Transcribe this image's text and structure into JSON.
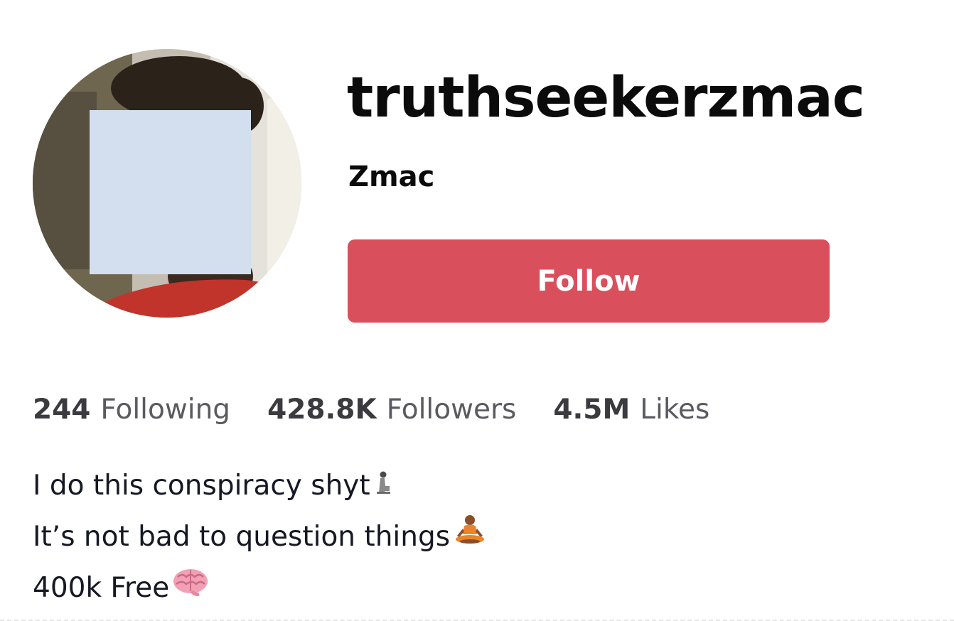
{
  "profile": {
    "username": "truthseekerzmac",
    "display_name": "Zmac",
    "follow_label": "Follow"
  },
  "stats": {
    "following": {
      "value": "244",
      "label": "Following"
    },
    "followers": {
      "value": "428.8K",
      "label": "Followers"
    },
    "likes": {
      "value": "4.5M",
      "label": "Likes"
    }
  },
  "bio": {
    "line1": "I do this conspiracy shyt",
    "line1_icon": "kneeling-person-emoji-icon",
    "line2": "It’s not bad to question things",
    "line2_icon": "lotus-position-emoji-icon",
    "line3": "400k Free",
    "line3_icon": "brain-emoji-icon"
  },
  "colors": {
    "follow_button": "#d9505c",
    "redaction": "#d3dfee"
  }
}
